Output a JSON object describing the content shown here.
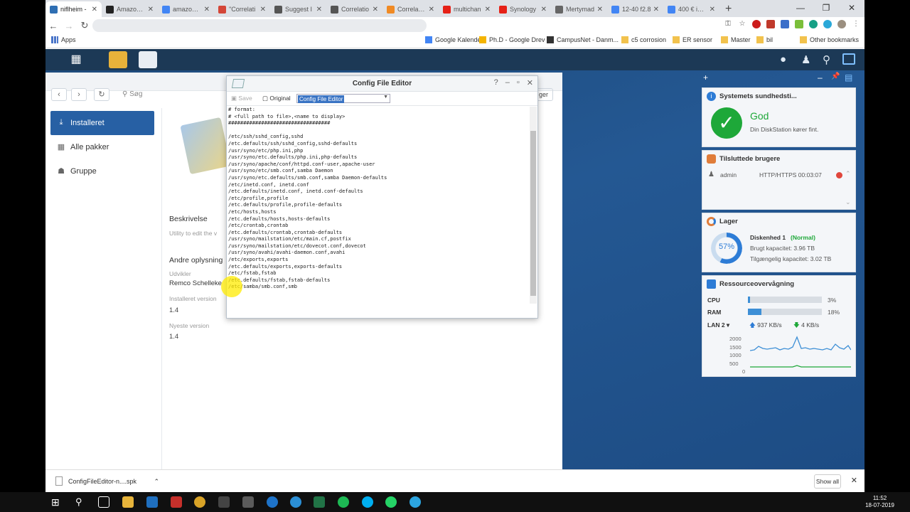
{
  "browser": {
    "tabs": [
      {
        "label": "niflheim - ",
        "active": true,
        "icon": "synology-favicon-icon",
        "color": "#2f6fb3"
      },
      {
        "label": "Amazon.de",
        "icon": "amazon-favicon-icon",
        "color": "#222222"
      },
      {
        "label": "amazon fa",
        "icon": "google-favicon-icon",
        "color": "#4285f4"
      },
      {
        "label": "\"Correlati",
        "icon": "gmail-favicon-icon",
        "color": "#d44638"
      },
      {
        "label": "Suggest I",
        "icon": "community-favicon-icon",
        "color": "#555555"
      },
      {
        "label": "Correlatio",
        "icon": "community-favicon-icon",
        "color": "#555555"
      },
      {
        "label": "Correlation",
        "icon": "f-favicon-icon",
        "color": "#f08a24"
      },
      {
        "label": "multichan",
        "icon": "youtube-favicon-icon",
        "color": "#e62117"
      },
      {
        "label": "Synology",
        "icon": "youtube-favicon-icon",
        "color": "#e62117"
      },
      {
        "label": "Mertymad",
        "icon": "globe-favicon-icon",
        "color": "#666666"
      },
      {
        "label": "12-40 f2.8",
        "icon": "google-favicon-icon",
        "color": "#4285f4"
      },
      {
        "label": "400 € in dk",
        "icon": "google-favicon-icon",
        "color": "#4285f4"
      }
    ],
    "new_tab": "+",
    "window_controls": {
      "minimize": "—",
      "maximize": "❐",
      "close": "✕"
    },
    "bookmarks": {
      "apps": "Apps",
      "items": [
        "Google Kalender",
        "Ph.D - Google Drev",
        "CampusNet - Danm...",
        "c5 corrosion",
        "ER sensor",
        "Master",
        "bil"
      ],
      "other": "Other bookmarks"
    }
  },
  "app_window": {
    "search_placeholder": "Søg",
    "sidebar": [
      {
        "label": "Installeret",
        "selected": true
      },
      {
        "label": "Alle pakker",
        "selected": false
      },
      {
        "label": "Gruppe",
        "selected": false
      }
    ],
    "description_heading": "Beskrivelse",
    "description_text": "Utility to edit the v",
    "other_info_heading": "Andre oplysning",
    "developer_label": "Udvikler",
    "developer_value": "Remco Schelleke",
    "installed_version_label": "Installeret version",
    "installed_version_value": "1.4",
    "latest_version_label": "Nyeste version",
    "latest_version_value": "1.4",
    "right_button_fragment": "ger"
  },
  "config_editor": {
    "title": "Config File Editor",
    "save_label": "Save",
    "original_label": "Original",
    "selected_file": "Config File Editor",
    "content": "# format:\n# <full path to file>,<name to display>\n##################################\n\n/etc/ssh/sshd_config,sshd\n/etc.defaults/ssh/sshd_config,sshd-defaults\n/usr/syno/etc/php.ini,php\n/usr/syno/etc.defaults/php.ini,php-defaults\n/usr/syno/apache/conf/httpd.conf-user,apache-user\n/usr/syno/etc/smb.conf,samba Daemon\n/usr/syno/etc.defaults/smb.conf,samba Daemon-defaults\n/etc/inetd.conf, inetd.conf\n/etc.defaults/inetd.conf, inetd.conf-defaults\n/etc/profile,profile\n/etc.defaults/profile,profile-defaults\n/etc/hosts,hosts\n/etc.defaults/hosts,hosts-defaults\n/etc/crontab,crontab\n/etc.defaults/crontab,crontab-defaults\n/usr/syno/mailstation/etc/main.cf,postfix\n/usr/syno/mailstation/etc/dovecot.conf,dovecot\n/usr/syno/avahi/avahi-daemon.conf,avahi\n/etc/exports,exports\n/etc.defaults/exports,exports-defaults\n/etc/fstab,fstab\n/etc.defaults/fstab,fstab-defaults\n/etc/samba/smb.conf,smb"
  },
  "widgets": {
    "health": {
      "title": "Systemets sundhedsti...",
      "status": "God",
      "message": "Din DiskStation kører fint.",
      "color": "#1ea839"
    },
    "users": {
      "title": "Tilsluttede brugere",
      "user": "admin",
      "session": "HTTP/HTTPS 00:03:07"
    },
    "storage": {
      "title": "Lager",
      "percent": "57%",
      "percent_value": 57,
      "disk": "Diskenhed 1",
      "disk_status": "Normal",
      "used": "Brugt kapacitet: 3.96 TB",
      "free": "Tilgængelig kapacitet: 3.02 TB"
    },
    "resources": {
      "title": "Ressourceovervågning",
      "cpu_label": "CPU",
      "cpu_value": "3%",
      "cpu_fraction": 0.03,
      "ram_label": "RAM",
      "ram_value": "18%",
      "ram_fraction": 0.18,
      "lan_label": "LAN 2",
      "upload": "937 KB/s",
      "download": "4 KB/s",
      "chart_ticks": [
        "2000",
        "1500",
        "1000",
        "500",
        "0"
      ]
    }
  },
  "downloads": {
    "file": "ConfigFileEditor-n....spk",
    "show_all": "Show all"
  },
  "taskbar": {
    "time": "11:52",
    "date": "18-07-2019"
  }
}
